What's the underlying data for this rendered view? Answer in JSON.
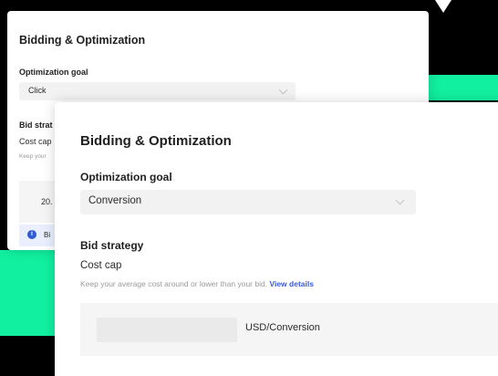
{
  "colors": {
    "background": "#000000",
    "accent_green": "#11f0a0",
    "link_blue": "#3a5bd9",
    "info_bar": "#e9efff"
  },
  "back_card": {
    "title": "Bidding & Optimization",
    "optimization_goal_label": "Optimization goal",
    "optimization_goal_value": "Click",
    "bid_strategy_label": "Bid strat",
    "cost_cap_label": "Cost cap",
    "hint_text": "Keep your",
    "amount_value": "20.",
    "info_text": "Bi"
  },
  "front_card": {
    "title": "Bidding & Optimization",
    "optimization_goal_label": "Optimization goal",
    "optimization_goal_value": "Conversion",
    "bid_strategy_label": "Bid strategy",
    "cost_cap_label": "Cost cap",
    "hint_text": "Keep your average cost around or lower than your bid.",
    "hint_link": "View details",
    "bid_amount_value": "",
    "bid_unit": "USD/Conversion"
  }
}
